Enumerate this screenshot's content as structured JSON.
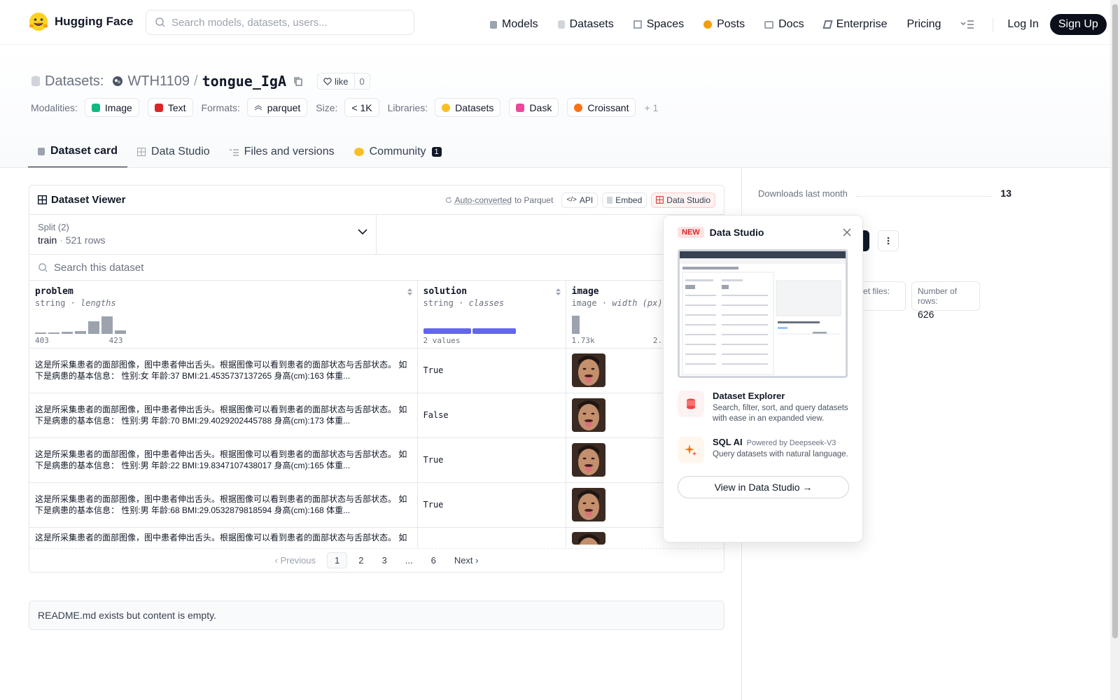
{
  "nav": {
    "brand": "Hugging Face",
    "search_placeholder": "Search models, datasets, users...",
    "links": [
      {
        "label": "Models",
        "icon": "cube-icon",
        "color": "#9ca3af"
      },
      {
        "label": "Datasets",
        "icon": "database-icon",
        "color": "#9ca3af"
      },
      {
        "label": "Spaces",
        "icon": "grid-icon",
        "color": "#9ca3af"
      },
      {
        "label": "Posts",
        "icon": "chat-bubble-icon",
        "color": "#f59e0b"
      },
      {
        "label": "Docs",
        "icon": "book-icon",
        "color": "#9ca3af"
      },
      {
        "label": "Enterprise",
        "icon": "enterprise-icon",
        "color": "#6b7280"
      },
      {
        "label": "Pricing",
        "icon": "",
        "color": ""
      }
    ],
    "login": "Log In",
    "signup": "Sign Up"
  },
  "header": {
    "datasets_label": "Datasets:",
    "owner": "WTH1109",
    "separator": "/",
    "name": "tongue_IgA",
    "like_label": "like",
    "like_count": "0",
    "modalities_label": "Modalities:",
    "modalities": [
      {
        "label": "Image",
        "color": "#10b981"
      },
      {
        "label": "Text",
        "color": "#dc2626"
      }
    ],
    "formats_label": "Formats:",
    "formats": [
      {
        "label": "parquet"
      }
    ],
    "size_label": "Size:",
    "size": "< 1K",
    "libraries_label": "Libraries:",
    "libraries": [
      {
        "label": "Datasets",
        "color": "#fbbf24"
      },
      {
        "label": "Dask",
        "color": "#ec4899"
      },
      {
        "label": "Croissant",
        "color": "#f97316"
      }
    ],
    "libraries_more": "+ 1"
  },
  "tabs": [
    {
      "label": "Dataset card",
      "active": true
    },
    {
      "label": "Data Studio",
      "active": false
    },
    {
      "label": "Files and versions",
      "active": false
    },
    {
      "label": "Community",
      "active": false,
      "badge": "1"
    }
  ],
  "viewer": {
    "title": "Dataset Viewer",
    "auto_converted": "Auto-converted",
    "to_parquet": "to Parquet",
    "api_label": "API",
    "embed_label": "Embed",
    "studio_label": "Data Studio",
    "split_label": "Split (2)",
    "split_value": "train",
    "split_rows": "521 rows",
    "search_placeholder": "Search this dataset",
    "columns": [
      {
        "name": "problem",
        "type": "string",
        "stat": "lengths",
        "min": "403",
        "max": "423",
        "hist": [
          0.05,
          0.05,
          0.1,
          0.15,
          0.65,
          0.9,
          0.18
        ]
      },
      {
        "name": "solution",
        "type": "string",
        "stat": "classes",
        "summary": "2 values",
        "class_split": [
          0.52,
          0.48
        ]
      },
      {
        "name": "image",
        "type": "image",
        "stat": "width (px)",
        "min": "1.73k",
        "max": "2.59k"
      }
    ],
    "rows": [
      {
        "problem": "这是所采集患者的面部图像，图中患者伸出舌头。根据图像可以看到患者的面部状态与舌部状态。 如下是病患的基本信息： 性别:女 年龄:37 BMI:21.4535737137265 身高(cm):163 体重...",
        "solution": "True"
      },
      {
        "problem": "这是所采集患者的面部图像，图中患者伸出舌头。根据图像可以看到患者的面部状态与舌部状态。 如下是病患的基本信息： 性别:男 年龄:70 BMI:29.4029202445788 身高(cm):173 体重...",
        "solution": "False"
      },
      {
        "problem": "这是所采集患者的面部图像，图中患者伸出舌头。根据图像可以看到患者的面部状态与舌部状态。 如下是病患的基本信息： 性别:男 年龄:22 BMI:19.8347107438017 身高(cm):165 体重...",
        "solution": "True"
      },
      {
        "problem": "这是所采集患者的面部图像，图中患者伸出舌头。根据图像可以看到患者的面部状态与舌部状态。 如下是病患的基本信息： 性别:男 年龄:68 BMI:29.0532879818594 身高(cm):168 体重...",
        "solution": "True"
      },
      {
        "problem": "这是所采集患者的面部图像，图中患者伸出舌头。根据图像可以看到患者的面部状态与舌部状态。 如",
        "solution": ""
      }
    ],
    "pagination": {
      "previous": "Previous",
      "pages": [
        "1",
        "2",
        "3",
        "...",
        "6"
      ],
      "current": "1",
      "next": "Next"
    }
  },
  "readme": "README.md exists but content is empty.",
  "sidebar": {
    "downloads_label": "Downloads last month",
    "downloads": "13",
    "parquet_label": "arquet files:",
    "rows_label": "Number of rows:",
    "rows_value": "626"
  },
  "popover": {
    "new_tag": "NEW",
    "title": "Data Studio",
    "features": [
      {
        "title": "Dataset Explorer",
        "note": "",
        "desc": "Search, filter, sort, and query datasets with ease in an expanded view.",
        "icon": "database-icon"
      },
      {
        "title": "SQL AI",
        "note": "Powered by Deepseek-V3",
        "desc": "Query datasets with natural language.",
        "icon": "sparkle-icon"
      }
    ],
    "button": "View in Data Studio →"
  },
  "colors": {
    "accent_red": "#ef4444",
    "dark": "#0b0f19",
    "class_bar": "#6366f1"
  }
}
